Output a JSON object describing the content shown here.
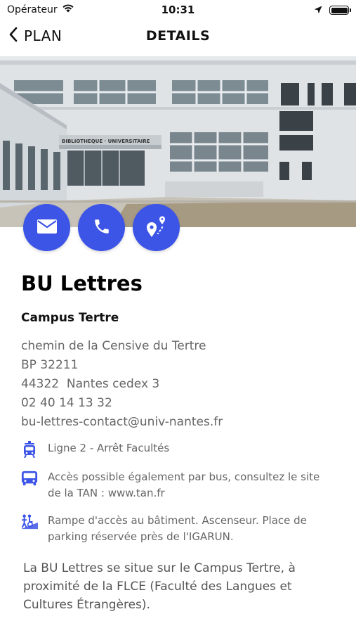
{
  "status_bar": {
    "carrier": "Opérateur",
    "time": "10:31"
  },
  "nav": {
    "back_label": "PLAN",
    "title": "DETAILS"
  },
  "hero": {
    "sign_text": "BIBLIOTHEQUE · UNIVERSITAIRE"
  },
  "actions": [
    {
      "icon": "mail-icon"
    },
    {
      "icon": "phone-icon"
    },
    {
      "icon": "route-icon"
    }
  ],
  "place": {
    "name": "BU Lettres",
    "campus": "Campus Tertre",
    "address_lines": [
      "chemin de la Censive du Tertre",
      "BP 32211",
      "44322  Nantes cedex 3",
      "02 40 14 13 32",
      "bu-lettres-contact@univ-nantes.fr"
    ],
    "access": [
      {
        "icon": "tram-icon",
        "text": "Ligne 2 - Arrêt Facultés"
      },
      {
        "icon": "bus-icon",
        "text": "Accès possible également par bus, consultez le site de la TAN : www.tan.fr"
      },
      {
        "icon": "accessibility-icon",
        "text": "Rampe d'accès au bâtiment. Ascenseur. Place de parking réservée près de l'IGARUN."
      }
    ],
    "description": "La BU Lettres se situe sur le Campus Tertre, à proximité de la FLCE (Faculté des Langues et Cultures Étrangères)."
  },
  "colors": {
    "accent": "#3d55e6"
  }
}
